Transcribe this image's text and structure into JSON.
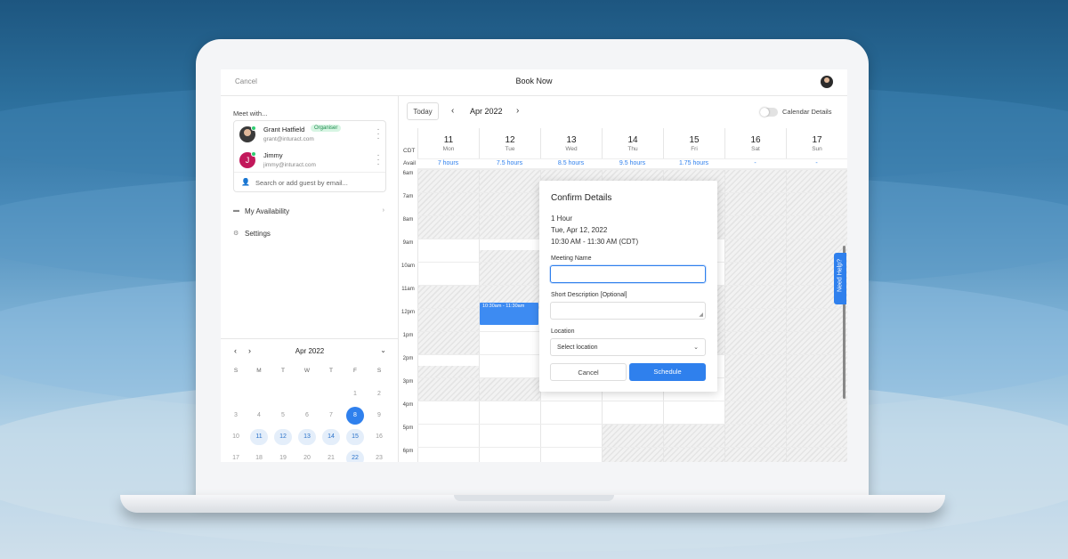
{
  "header": {
    "cancel_label": "Cancel",
    "title": "Book Now"
  },
  "sidebar": {
    "meet_with_label": "Meet with...",
    "guests": [
      {
        "name": "Grant Hatfield",
        "email": "grant@inturact.com",
        "badge": "Organiser"
      },
      {
        "name": "Jimmy",
        "email": "jimmy@inturact.com",
        "initial": "J"
      }
    ],
    "search_placeholder": "Search or add guest by email...",
    "menu": [
      {
        "label": "My Availability",
        "icon": "calendar-icon"
      },
      {
        "label": "Settings",
        "icon": "gear-icon"
      }
    ]
  },
  "mini_calendar": {
    "month": "Apr 2022",
    "weekdays": [
      "S",
      "M",
      "T",
      "W",
      "T",
      "F",
      "S"
    ],
    "days": [
      "1",
      "2",
      "3",
      "4",
      "5",
      "6",
      "7",
      "8",
      "9",
      "10",
      "11",
      "12",
      "13",
      "14",
      "15",
      "16",
      "17",
      "18",
      "19",
      "20",
      "21",
      "22",
      "23"
    ],
    "selected": "8",
    "available": [
      "11",
      "12",
      "13",
      "14",
      "15",
      "22"
    ]
  },
  "calendar": {
    "today_label": "Today",
    "month": "Apr 2022",
    "details_toggle_label": "Calendar Details",
    "tz": "CDT",
    "avail_label": "Avail",
    "days": [
      {
        "num": "11",
        "wd": "Mon",
        "avail": "7 hours"
      },
      {
        "num": "12",
        "wd": "Tue",
        "avail": "7.5 hours"
      },
      {
        "num": "13",
        "wd": "Wed",
        "avail": "8.5 hours"
      },
      {
        "num": "14",
        "wd": "Thu",
        "avail": "9.5 hours"
      },
      {
        "num": "15",
        "wd": "Fri",
        "avail": "1.75 hours"
      },
      {
        "num": "16",
        "wd": "Sat",
        "avail": "-"
      },
      {
        "num": "17",
        "wd": "Sun",
        "avail": "-"
      }
    ],
    "hours": [
      "6am",
      "7am",
      "8am",
      "9am",
      "10am",
      "11am",
      "12pm",
      "1pm",
      "2pm",
      "3pm",
      "4pm",
      "5pm",
      "6pm"
    ],
    "event_label": "10:30am - 11:30am"
  },
  "modal": {
    "title": "Confirm Details",
    "duration": "1 Hour",
    "date": "Tue, Apr 12, 2022",
    "time": "10:30 AM - 11:30 AM (CDT)",
    "meeting_name_label": "Meeting Name",
    "meeting_name_value": "",
    "description_label": "Short Description [Optional]",
    "location_label": "Location",
    "location_value": "Select location",
    "cancel_label": "Cancel",
    "schedule_label": "Schedule"
  },
  "help_label": "Need Help?",
  "colors": {
    "accent": "#2f80ed",
    "online": "#2ecc71",
    "organiser_badge": "#d7f5e3",
    "jimmy_avatar": "#c2185b"
  }
}
